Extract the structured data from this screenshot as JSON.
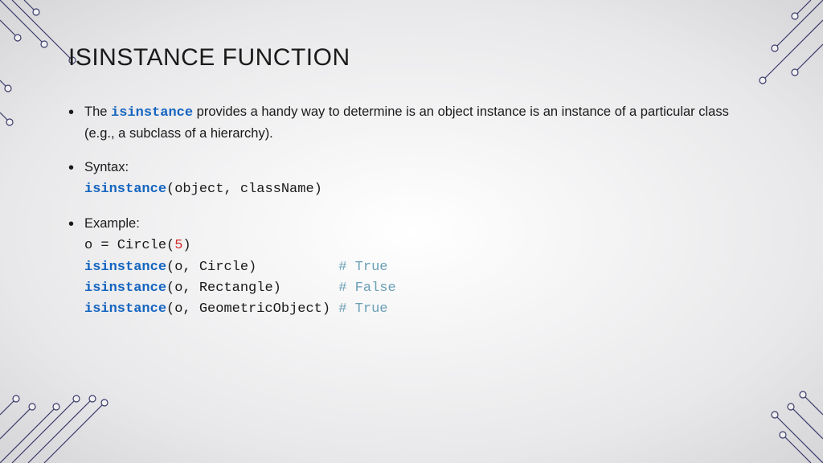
{
  "title": "ISINSTANCE FUNCTION",
  "bullet1": {
    "pre": "The ",
    "kw": "isinstance",
    "post": " provides a handy way to determine is an object instance is an instance of a particular class (e.g., a subclass of a hierarchy)."
  },
  "bullet2": {
    "label": "Syntax:",
    "kw": "isinstance",
    "args": "(object, className)"
  },
  "bullet3": {
    "label": "Example:",
    "line1_pre": "o = Circle(",
    "line1_num": "5",
    "line1_post": ")",
    "line2_kw": "isinstance",
    "line2_args": "(o, Circle)          ",
    "line2_cm": "# True",
    "line3_kw": "isinstance",
    "line3_args": "(o, Rectangle)       ",
    "line3_cm": "# False",
    "line4_kw": "isinstance",
    "line4_args": "(o, GeometricObject) ",
    "line4_cm": "# True"
  }
}
